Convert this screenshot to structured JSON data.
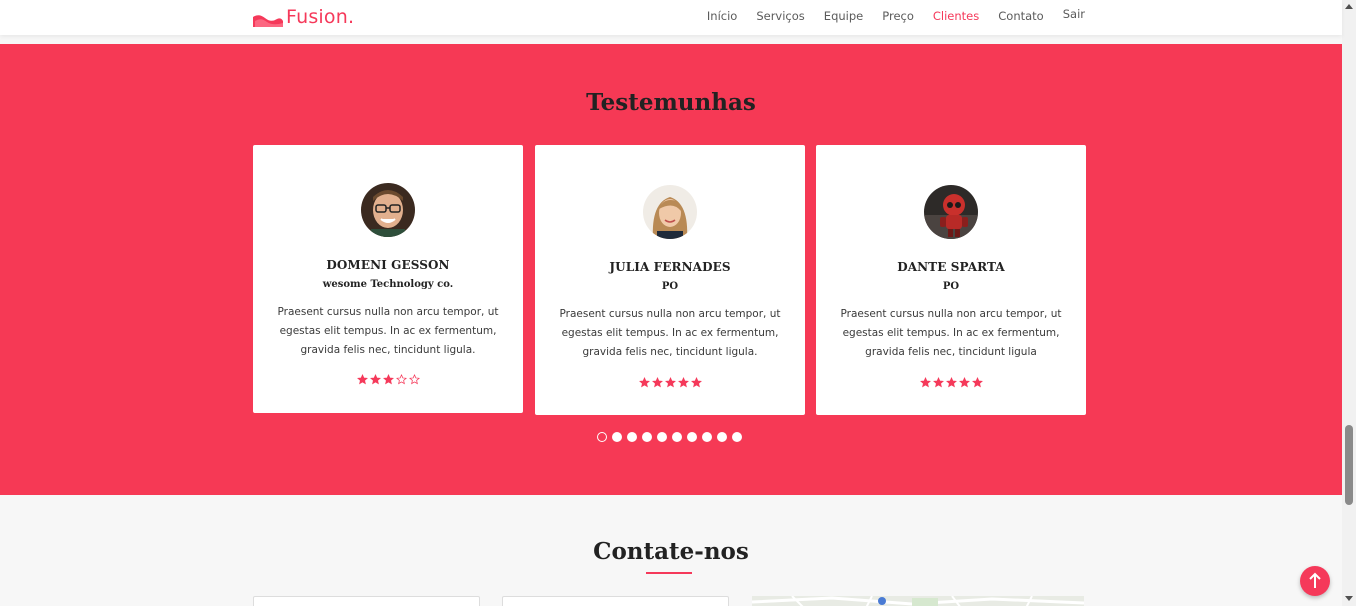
{
  "header": {
    "brand": "Fusion.",
    "nav": [
      "Início",
      "Serviços",
      "Equipe",
      "Preço",
      "Clientes",
      "Contato",
      "Sair"
    ],
    "active": "Clientes"
  },
  "testimonials": {
    "title": "Testemunhas",
    "cards": [
      {
        "name": "DOMENI GESSON",
        "role": "wesome Technology co.",
        "text": "Praesent cursus nulla non arcu tempor, ut egestas elit tempus. In ac ex fermentum, gravida felis nec, tincidunt ligula.",
        "rating": 3,
        "avatar_icon": "man-with-glasses-avatar"
      },
      {
        "name": "JULIA FERNADES",
        "role": "PO",
        "text": "Praesent cursus nulla non arcu tempor, ut egestas elit tempus. In ac ex fermentum, gravida felis nec, tincidunt ligula.",
        "rating": 5,
        "avatar_icon": "woman-avatar"
      },
      {
        "name": "DANTE SPARTA",
        "role": "PO",
        "text": "Praesent cursus nulla non arcu tempor, ut egestas elit tempus. In ac ex fermentum, gravida felis nec, tincidunt ligula",
        "rating": 5,
        "avatar_icon": "robot-avatar"
      }
    ],
    "pagination_pages": 10,
    "pagination_current": 1
  },
  "contact": {
    "title": "Contate-nos"
  },
  "colors": {
    "accent": "#f5395a",
    "section_bg": "#f63955",
    "star": "#f5395a"
  }
}
